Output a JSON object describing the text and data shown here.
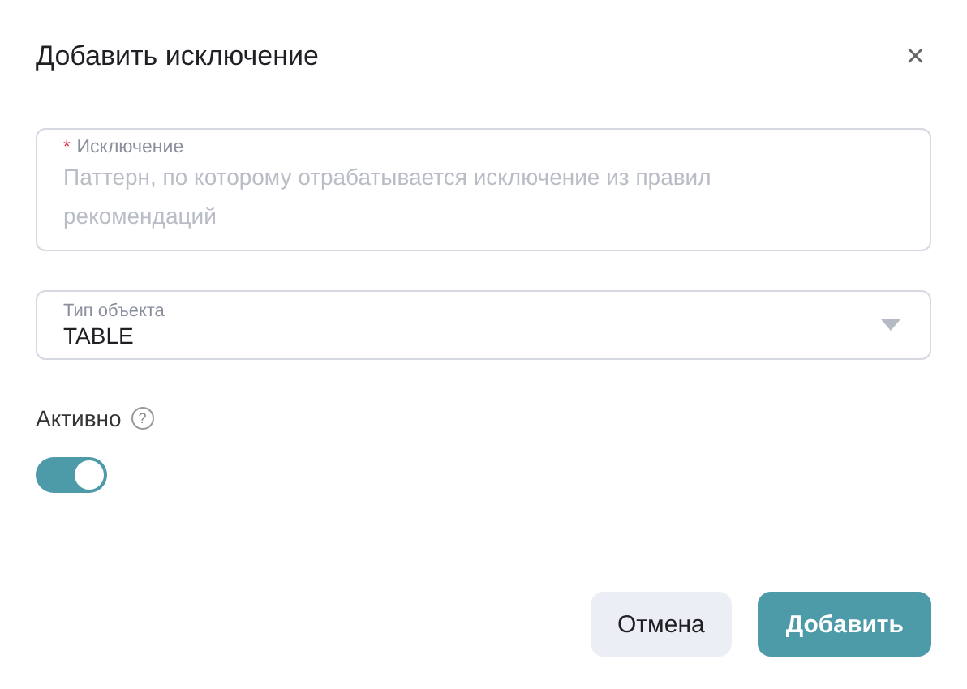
{
  "dialog": {
    "title": "Добавить исключение",
    "close": "×"
  },
  "exception_field": {
    "label": "Исключение",
    "required_mark": "*",
    "placeholder": "Паттерн, по которому отрабатывается исключение из правил рекомендаций"
  },
  "object_type_field": {
    "label": "Тип объекта",
    "value": "TABLE"
  },
  "active": {
    "label": "Активно",
    "help": "?",
    "on": true
  },
  "buttons": [
    {
      "label": "Отмена",
      "kind": "secondary"
    },
    {
      "label": "Добавить",
      "kind": "primary"
    }
  ]
}
